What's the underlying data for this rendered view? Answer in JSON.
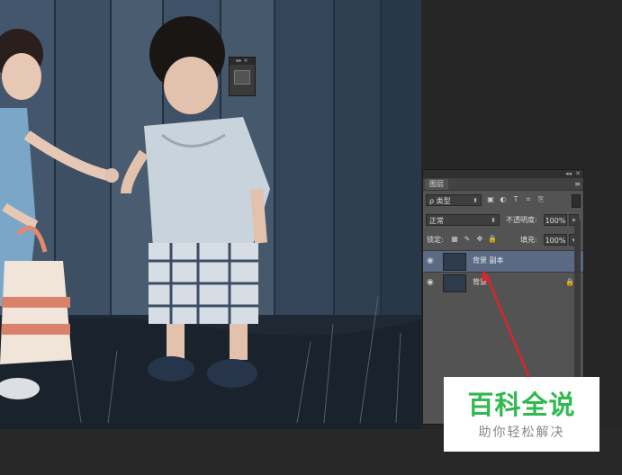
{
  "photo": {
    "description_icon": "photo-canvas"
  },
  "mini_panel": {
    "header": "▸▸ ✕",
    "icon": "navigator-icon"
  },
  "layers_panel": {
    "header_controls": {
      "collapse": "◂◂",
      "close": "✕"
    },
    "tab_label": "图层",
    "menu_icon": "≡",
    "filter": {
      "kind_label": "ρ 类型",
      "icons": [
        "▣",
        "◐",
        "T",
        "⌗",
        "⎘"
      ]
    },
    "blend_mode": "正常",
    "opacity_label": "不透明度:",
    "opacity_value": "100%",
    "lock_label": "锁定:",
    "lock_icons": [
      "▦",
      "✎",
      "✥",
      "🔒"
    ],
    "fill_label": "填充:",
    "fill_value": "100%",
    "layers": [
      {
        "name": "背景 副本",
        "selected": true,
        "visible": true
      },
      {
        "name": "背景",
        "selected": false,
        "visible": true,
        "locked": true
      }
    ]
  },
  "watermark": {
    "title": "百科全说",
    "subtitle": "助你轻松解决"
  },
  "colors": {
    "accent_green": "#2fb94f",
    "selected_layer": "#5a6a85",
    "arrow_red": "#d8262b"
  }
}
